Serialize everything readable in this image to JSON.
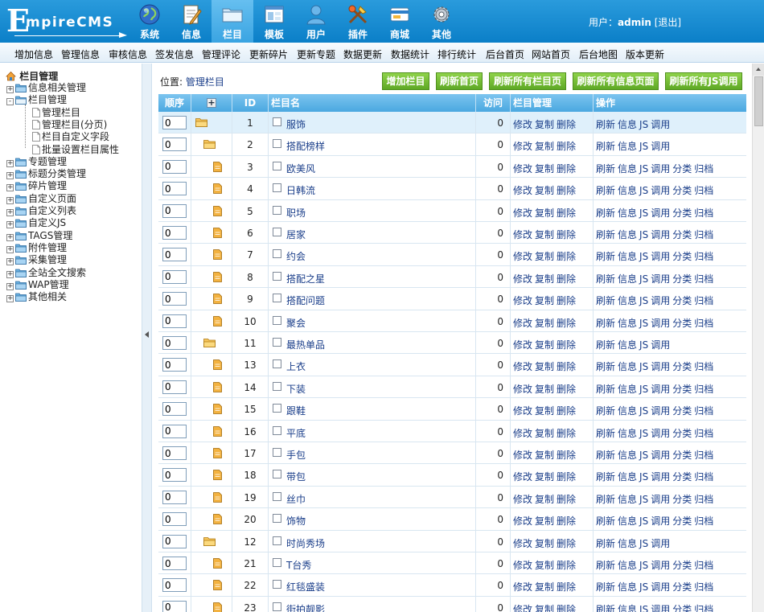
{
  "header": {
    "logo_initial": "E",
    "logo_rest": "mpireCMS",
    "nav": [
      {
        "label": "系统",
        "icon": "globe-icon"
      },
      {
        "label": "信息",
        "icon": "document-edit-icon"
      },
      {
        "label": "栏目",
        "icon": "folder-icon",
        "active": true
      },
      {
        "label": "模板",
        "icon": "template-window-icon"
      },
      {
        "label": "用户",
        "icon": "user-icon"
      },
      {
        "label": "插件",
        "icon": "tools-icon"
      },
      {
        "label": "商城",
        "icon": "shop-card-icon"
      },
      {
        "label": "其他",
        "icon": "gear-icon"
      }
    ],
    "user_prefix": "用户：",
    "username": "admin",
    "logout": "[退出]"
  },
  "subnav": [
    "增加信息",
    "管理信息",
    "审核信息",
    "签发信息",
    "管理评论",
    "更新碎片",
    "更新专题",
    "数据更新",
    "数据统计",
    "排行统计",
    "后台首页",
    "网站首页",
    "后台地图",
    "版本更新"
  ],
  "sidebar": {
    "title": "栏目管理",
    "tree": [
      {
        "label": "信息相关管理",
        "type": "folder",
        "pm": "+"
      },
      {
        "label": "栏目管理",
        "type": "folder",
        "pm": "-"
      },
      {
        "label": "管理栏目",
        "type": "doc",
        "child": true
      },
      {
        "label": "管理栏目(分页)",
        "type": "doc",
        "child": true
      },
      {
        "label": "栏目自定义字段",
        "type": "doc",
        "child": true
      },
      {
        "label": "批量设置栏目属性",
        "type": "doc",
        "child": true
      },
      {
        "label": "专题管理",
        "type": "folder",
        "pm": "+"
      },
      {
        "label": "标题分类管理",
        "type": "folder",
        "pm": "+"
      },
      {
        "label": "碎片管理",
        "type": "folder",
        "pm": "+"
      },
      {
        "label": "自定义页面",
        "type": "folder",
        "pm": "+"
      },
      {
        "label": "自定义列表",
        "type": "folder",
        "pm": "+"
      },
      {
        "label": "自定义JS",
        "type": "folder",
        "pm": "+"
      },
      {
        "label": "TAGS管理",
        "type": "folder",
        "pm": "+"
      },
      {
        "label": "附件管理",
        "type": "folder",
        "pm": "+"
      },
      {
        "label": "采集管理",
        "type": "folder",
        "pm": "+"
      },
      {
        "label": "全站全文搜索",
        "type": "folder",
        "pm": "+"
      },
      {
        "label": "WAP管理",
        "type": "folder",
        "pm": "+"
      },
      {
        "label": "其他相关",
        "type": "folder",
        "pm": "+"
      }
    ]
  },
  "main": {
    "location_prefix": "位置: ",
    "location_link": "管理栏目",
    "buttons": [
      "增加栏目",
      "刷新首页",
      "刷新所有栏目页",
      "刷新所有信息页面",
      "刷新所有JS调用"
    ],
    "columns": {
      "order": "顺序",
      "expand": "+",
      "id": "ID",
      "name": "栏目名",
      "visits": "访问",
      "manage": "栏目管理",
      "ops": "操作"
    },
    "manage_actions": [
      "修改",
      "复制",
      "删除"
    ],
    "ops_parent": [
      "刷新",
      "信息",
      "JS",
      "调用"
    ],
    "ops_leaf": [
      "刷新",
      "信息",
      "JS",
      "调用",
      "分类",
      "归档"
    ],
    "rows": [
      {
        "order": "0",
        "id": "1",
        "name": "服饰",
        "level": 0,
        "kind": "folder",
        "visits": "0",
        "highlight": true
      },
      {
        "order": "0",
        "id": "2",
        "name": "搭配榜样",
        "level": 1,
        "kind": "folder",
        "visits": "0"
      },
      {
        "order": "0",
        "id": "3",
        "name": "欧美风",
        "level": 2,
        "kind": "leaf",
        "visits": "0"
      },
      {
        "order": "0",
        "id": "4",
        "name": "日韩流",
        "level": 2,
        "kind": "leaf",
        "visits": "0"
      },
      {
        "order": "0",
        "id": "5",
        "name": "职场",
        "level": 2,
        "kind": "leaf",
        "visits": "0"
      },
      {
        "order": "0",
        "id": "6",
        "name": "居家",
        "level": 2,
        "kind": "leaf",
        "visits": "0"
      },
      {
        "order": "0",
        "id": "7",
        "name": "约会",
        "level": 2,
        "kind": "leaf",
        "visits": "0"
      },
      {
        "order": "0",
        "id": "8",
        "name": "搭配之星",
        "level": 2,
        "kind": "leaf",
        "visits": "0"
      },
      {
        "order": "0",
        "id": "9",
        "name": "搭配问题",
        "level": 2,
        "kind": "leaf",
        "visits": "0"
      },
      {
        "order": "0",
        "id": "10",
        "name": "聚会",
        "level": 2,
        "kind": "leaf",
        "visits": "0"
      },
      {
        "order": "0",
        "id": "11",
        "name": "最热单品",
        "level": 1,
        "kind": "folder",
        "visits": "0"
      },
      {
        "order": "0",
        "id": "13",
        "name": "上衣",
        "level": 2,
        "kind": "leaf",
        "visits": "0"
      },
      {
        "order": "0",
        "id": "14",
        "name": "下装",
        "level": 2,
        "kind": "leaf",
        "visits": "0"
      },
      {
        "order": "0",
        "id": "15",
        "name": "跟鞋",
        "level": 2,
        "kind": "leaf",
        "visits": "0"
      },
      {
        "order": "0",
        "id": "16",
        "name": "平底",
        "level": 2,
        "kind": "leaf",
        "visits": "0"
      },
      {
        "order": "0",
        "id": "17",
        "name": "手包",
        "level": 2,
        "kind": "leaf",
        "visits": "0"
      },
      {
        "order": "0",
        "id": "18",
        "name": "带包",
        "level": 2,
        "kind": "leaf",
        "visits": "0"
      },
      {
        "order": "0",
        "id": "19",
        "name": "丝巾",
        "level": 2,
        "kind": "leaf",
        "visits": "0"
      },
      {
        "order": "0",
        "id": "20",
        "name": "饰物",
        "level": 2,
        "kind": "leaf",
        "visits": "0"
      },
      {
        "order": "0",
        "id": "12",
        "name": "时尚秀场",
        "level": 1,
        "kind": "folder",
        "visits": "0"
      },
      {
        "order": "0",
        "id": "21",
        "name": "T台秀",
        "level": 2,
        "kind": "leaf",
        "visits": "0"
      },
      {
        "order": "0",
        "id": "22",
        "name": "红毯盛装",
        "level": 2,
        "kind": "leaf",
        "visits": "0"
      },
      {
        "order": "0",
        "id": "23",
        "name": "街拍靓影",
        "level": 2,
        "kind": "leaf",
        "visits": "0"
      }
    ]
  },
  "colors": {
    "header": "#1588d1",
    "accent_button": "#6cb52f",
    "link": "#1a3e8a",
    "table_head": "#5ab2e6"
  }
}
